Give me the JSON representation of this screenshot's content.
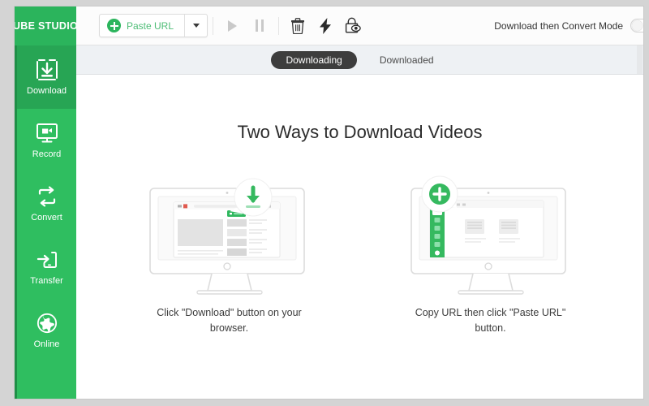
{
  "app": {
    "logo_text": "TUBE STUDIO",
    "brand_green": "#2fbe60",
    "brand_green_active": "#27a554",
    "accent_dark": "#3d3d3d"
  },
  "toolbar": {
    "paste_url_label": "Paste URL",
    "paste_url_icon": "plus-circle-icon",
    "dropdown_icon": "chevron-down-icon",
    "play_icon": "play-icon",
    "pause_icon": "pause-icon",
    "delete_icon": "trash-icon",
    "accelerate_icon": "lightning-bolt-icon",
    "privacy_icon": "lock-eye-icon",
    "mode_label": "Download then Convert Mode",
    "mode_toggle": "toggle-switch-off"
  },
  "sidebar": {
    "items": [
      {
        "label": "Download",
        "icon": "download-box-icon",
        "active": true
      },
      {
        "label": "Record",
        "icon": "screen-record-icon",
        "active": false
      },
      {
        "label": "Convert",
        "icon": "convert-arrows-icon",
        "active": false
      },
      {
        "label": "Transfer",
        "icon": "transfer-device-icon",
        "active": false
      },
      {
        "label": "Online",
        "icon": "globe-icon",
        "active": false
      }
    ]
  },
  "tabs": [
    {
      "label": "Downloading",
      "active": true
    },
    {
      "label": "Downloaded",
      "active": false
    }
  ],
  "main": {
    "headline": "Two Ways to Download Videos",
    "cards": [
      {
        "illustration": "monitor-browser-download-bubble-illustration",
        "caption": "Click \"Download\" button on your browser."
      },
      {
        "illustration": "monitor-app-plus-bubble-illustration",
        "caption": "Copy URL then click \"Paste URL\" button."
      }
    ]
  }
}
